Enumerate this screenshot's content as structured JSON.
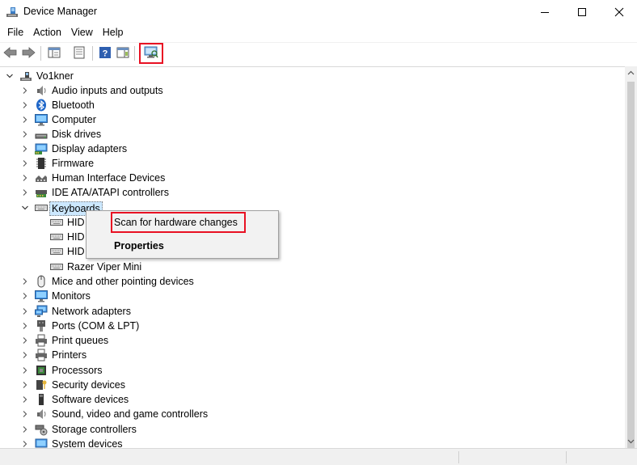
{
  "window": {
    "title": "Device Manager",
    "controls": [
      "minimize",
      "maximize",
      "close"
    ]
  },
  "menu": [
    "File",
    "Action",
    "View",
    "Help"
  ],
  "toolbar": {
    "buttons": [
      "back-icon",
      "forward-icon",
      "show-hide-console-tree-icon",
      "properties-icon",
      "help-icon",
      "show-action-pane-icon",
      "scan-hardware-icon"
    ]
  },
  "tree": {
    "root": "Vo1kner",
    "categories": [
      {
        "label": "Audio inputs and outputs",
        "icon": "speaker-icon"
      },
      {
        "label": "Bluetooth",
        "icon": "bluetooth-icon"
      },
      {
        "label": "Computer",
        "icon": "monitor-icon"
      },
      {
        "label": "Disk drives",
        "icon": "disk-drive-icon"
      },
      {
        "label": "Display adapters",
        "icon": "display-adapter-icon"
      },
      {
        "label": "Firmware",
        "icon": "firmware-chip-icon"
      },
      {
        "label": "Human Interface Devices",
        "icon": "hid-icon"
      },
      {
        "label": "IDE ATA/ATAPI controllers",
        "icon": "ide-controller-icon"
      },
      {
        "label": "Keyboards",
        "icon": "keyboard-icon",
        "expanded": true,
        "selected": true,
        "children": [
          "HID",
          "HID",
          "HID",
          "Razer Viper Mini"
        ]
      },
      {
        "label": "Mice and other pointing devices",
        "icon": "mouse-icon"
      },
      {
        "label": "Monitors",
        "icon": "monitor-icon"
      },
      {
        "label": "Network adapters",
        "icon": "network-adapter-icon"
      },
      {
        "label": "Ports (COM & LPT)",
        "icon": "port-icon"
      },
      {
        "label": "Print queues",
        "icon": "printer-icon"
      },
      {
        "label": "Printers",
        "icon": "printer-icon"
      },
      {
        "label": "Processors",
        "icon": "processor-icon"
      },
      {
        "label": "Security devices",
        "icon": "security-key-icon"
      },
      {
        "label": "Software devices",
        "icon": "software-device-icon"
      },
      {
        "label": "Sound, video and game controllers",
        "icon": "speaker-icon"
      },
      {
        "label": "Storage controllers",
        "icon": "storage-controller-icon"
      },
      {
        "label": "System devices",
        "icon": "system-device-icon"
      }
    ]
  },
  "context_menu": {
    "items": [
      "Scan for hardware changes",
      "Properties"
    ],
    "highlighted": "Scan for hardware changes",
    "bold": "Properties"
  },
  "colors": {
    "highlight_box": "#e81123",
    "selection": "#cce8ff"
  }
}
